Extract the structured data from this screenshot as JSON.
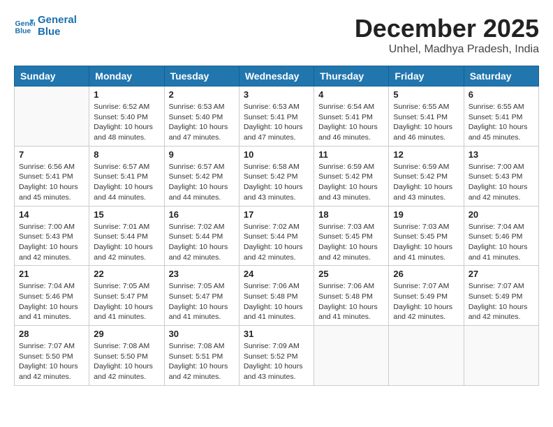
{
  "header": {
    "logo_line1": "General",
    "logo_line2": "Blue",
    "title": "December 2025",
    "subtitle": "Unhel, Madhya Pradesh, India"
  },
  "calendar": {
    "weekdays": [
      "Sunday",
      "Monday",
      "Tuesday",
      "Wednesday",
      "Thursday",
      "Friday",
      "Saturday"
    ],
    "weeks": [
      [
        {
          "day": "",
          "info": ""
        },
        {
          "day": "1",
          "info": "Sunrise: 6:52 AM\nSunset: 5:40 PM\nDaylight: 10 hours\nand 48 minutes."
        },
        {
          "day": "2",
          "info": "Sunrise: 6:53 AM\nSunset: 5:40 PM\nDaylight: 10 hours\nand 47 minutes."
        },
        {
          "day": "3",
          "info": "Sunrise: 6:53 AM\nSunset: 5:41 PM\nDaylight: 10 hours\nand 47 minutes."
        },
        {
          "day": "4",
          "info": "Sunrise: 6:54 AM\nSunset: 5:41 PM\nDaylight: 10 hours\nand 46 minutes."
        },
        {
          "day": "5",
          "info": "Sunrise: 6:55 AM\nSunset: 5:41 PM\nDaylight: 10 hours\nand 46 minutes."
        },
        {
          "day": "6",
          "info": "Sunrise: 6:55 AM\nSunset: 5:41 PM\nDaylight: 10 hours\nand 45 minutes."
        }
      ],
      [
        {
          "day": "7",
          "info": "Sunrise: 6:56 AM\nSunset: 5:41 PM\nDaylight: 10 hours\nand 45 minutes."
        },
        {
          "day": "8",
          "info": "Sunrise: 6:57 AM\nSunset: 5:41 PM\nDaylight: 10 hours\nand 44 minutes."
        },
        {
          "day": "9",
          "info": "Sunrise: 6:57 AM\nSunset: 5:42 PM\nDaylight: 10 hours\nand 44 minutes."
        },
        {
          "day": "10",
          "info": "Sunrise: 6:58 AM\nSunset: 5:42 PM\nDaylight: 10 hours\nand 43 minutes."
        },
        {
          "day": "11",
          "info": "Sunrise: 6:59 AM\nSunset: 5:42 PM\nDaylight: 10 hours\nand 43 minutes."
        },
        {
          "day": "12",
          "info": "Sunrise: 6:59 AM\nSunset: 5:42 PM\nDaylight: 10 hours\nand 43 minutes."
        },
        {
          "day": "13",
          "info": "Sunrise: 7:00 AM\nSunset: 5:43 PM\nDaylight: 10 hours\nand 42 minutes."
        }
      ],
      [
        {
          "day": "14",
          "info": "Sunrise: 7:00 AM\nSunset: 5:43 PM\nDaylight: 10 hours\nand 42 minutes."
        },
        {
          "day": "15",
          "info": "Sunrise: 7:01 AM\nSunset: 5:44 PM\nDaylight: 10 hours\nand 42 minutes."
        },
        {
          "day": "16",
          "info": "Sunrise: 7:02 AM\nSunset: 5:44 PM\nDaylight: 10 hours\nand 42 minutes."
        },
        {
          "day": "17",
          "info": "Sunrise: 7:02 AM\nSunset: 5:44 PM\nDaylight: 10 hours\nand 42 minutes."
        },
        {
          "day": "18",
          "info": "Sunrise: 7:03 AM\nSunset: 5:45 PM\nDaylight: 10 hours\nand 42 minutes."
        },
        {
          "day": "19",
          "info": "Sunrise: 7:03 AM\nSunset: 5:45 PM\nDaylight: 10 hours\nand 41 minutes."
        },
        {
          "day": "20",
          "info": "Sunrise: 7:04 AM\nSunset: 5:46 PM\nDaylight: 10 hours\nand 41 minutes."
        }
      ],
      [
        {
          "day": "21",
          "info": "Sunrise: 7:04 AM\nSunset: 5:46 PM\nDaylight: 10 hours\nand 41 minutes."
        },
        {
          "day": "22",
          "info": "Sunrise: 7:05 AM\nSunset: 5:47 PM\nDaylight: 10 hours\nand 41 minutes."
        },
        {
          "day": "23",
          "info": "Sunrise: 7:05 AM\nSunset: 5:47 PM\nDaylight: 10 hours\nand 41 minutes."
        },
        {
          "day": "24",
          "info": "Sunrise: 7:06 AM\nSunset: 5:48 PM\nDaylight: 10 hours\nand 41 minutes."
        },
        {
          "day": "25",
          "info": "Sunrise: 7:06 AM\nSunset: 5:48 PM\nDaylight: 10 hours\nand 41 minutes."
        },
        {
          "day": "26",
          "info": "Sunrise: 7:07 AM\nSunset: 5:49 PM\nDaylight: 10 hours\nand 42 minutes."
        },
        {
          "day": "27",
          "info": "Sunrise: 7:07 AM\nSunset: 5:49 PM\nDaylight: 10 hours\nand 42 minutes."
        }
      ],
      [
        {
          "day": "28",
          "info": "Sunrise: 7:07 AM\nSunset: 5:50 PM\nDaylight: 10 hours\nand 42 minutes."
        },
        {
          "day": "29",
          "info": "Sunrise: 7:08 AM\nSunset: 5:50 PM\nDaylight: 10 hours\nand 42 minutes."
        },
        {
          "day": "30",
          "info": "Sunrise: 7:08 AM\nSunset: 5:51 PM\nDaylight: 10 hours\nand 42 minutes."
        },
        {
          "day": "31",
          "info": "Sunrise: 7:09 AM\nSunset: 5:52 PM\nDaylight: 10 hours\nand 43 minutes."
        },
        {
          "day": "",
          "info": ""
        },
        {
          "day": "",
          "info": ""
        },
        {
          "day": "",
          "info": ""
        }
      ]
    ]
  }
}
